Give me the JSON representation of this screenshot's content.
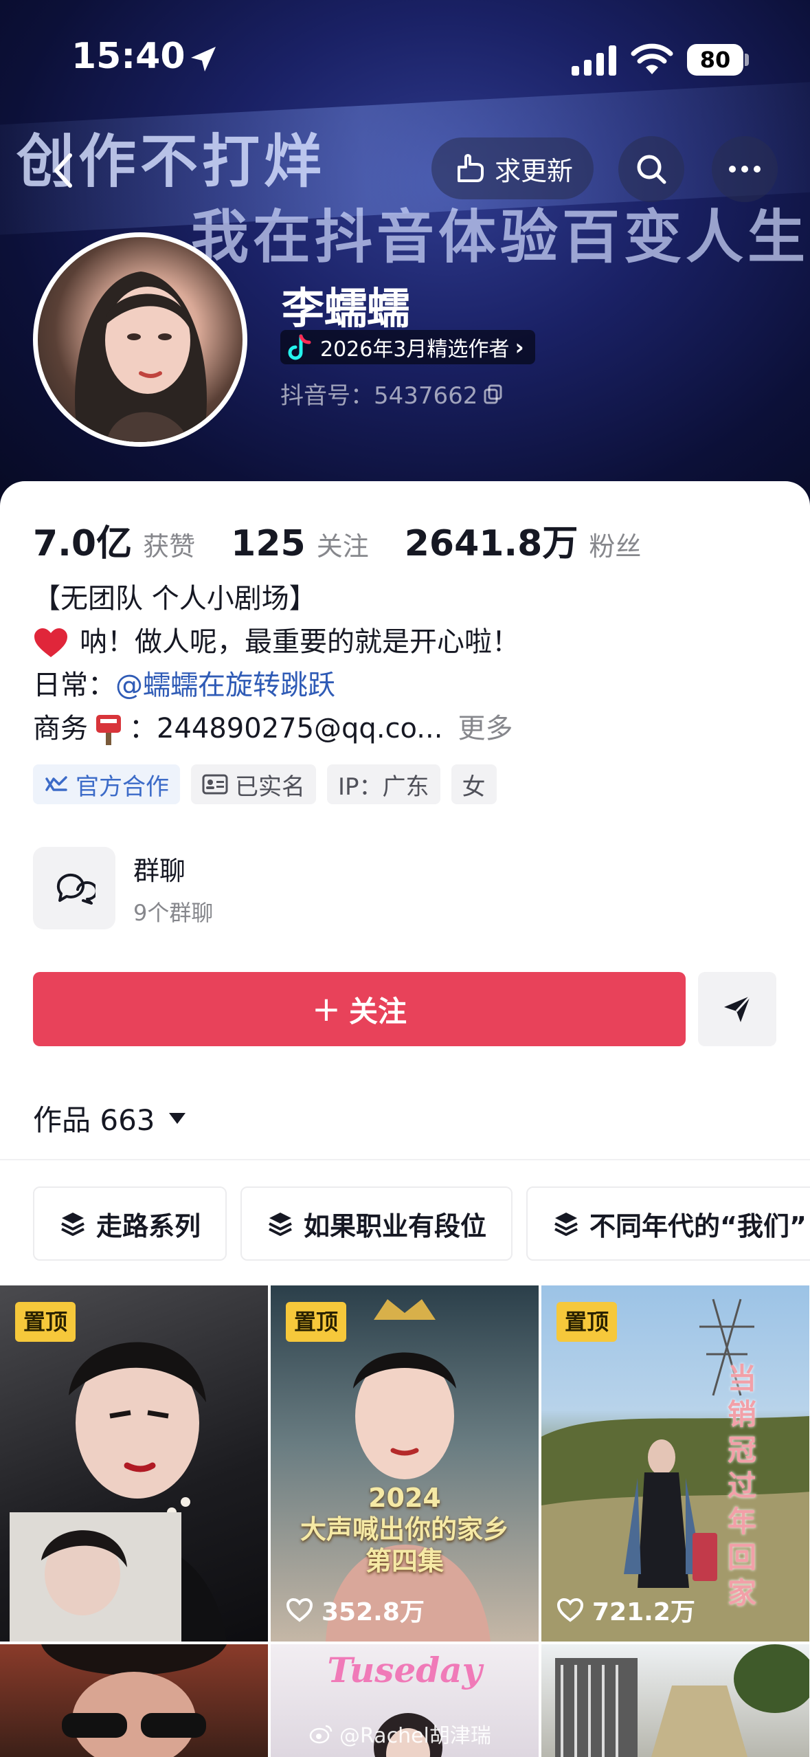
{
  "status_bar": {
    "time": "15:40",
    "battery": "80"
  },
  "banner": {
    "line1": "创作不打烊",
    "line2": "我在抖音体验百变人生"
  },
  "nav": {
    "request_update": "求更新"
  },
  "profile": {
    "name": "李蠕蠕",
    "creator_badge": "2026年3月精选作者",
    "douyin_id": "抖音号：5437662"
  },
  "stats": {
    "likes_value": "7.0亿",
    "likes_label": "获赞",
    "following_value": "125",
    "following_label": "关注",
    "fans_value": "2641.8万",
    "fans_label": "粉丝"
  },
  "bio": {
    "line1": "【无团队 个人小剧场】",
    "line2": "呐！做人呢，最重要的就是开心啦！",
    "line3_prefix": "日常：",
    "line3_link": "@蠕蠕在旋转跳跃",
    "line4_prefix": "商务",
    "line4_contact": "：244890275@qq.co...",
    "more": "更多"
  },
  "tags": [
    {
      "label": "官方合作"
    },
    {
      "label": "已实名"
    },
    {
      "label": "IP：广东"
    },
    {
      "label": "女"
    }
  ],
  "group_chat": {
    "title": "群聊",
    "subtitle": "9个群聊"
  },
  "actions": {
    "follow": "关注"
  },
  "works": {
    "label": "作品 663"
  },
  "collections": [
    "走路系列",
    "如果职业有段位",
    "不同年代的“我们”"
  ],
  "grid": {
    "pin_label": "置顶",
    "tiles": [
      {
        "likes": ""
      },
      {
        "likes": "352.8万",
        "overlay": "2024\n大声喊出你的家乡\n第四集"
      },
      {
        "likes": "721.2万",
        "overlay": "当销冠过年回家"
      },
      {
        "likes": ""
      },
      {
        "likes": "",
        "overlay": "Tuseday"
      },
      {
        "likes": ""
      }
    ]
  },
  "watermark": "@Rachel胡津瑞",
  "colors": {
    "accent": "#e8425a",
    "link": "#2f5bb6",
    "pin": "#f6c83b",
    "banner": "#1a2165"
  }
}
